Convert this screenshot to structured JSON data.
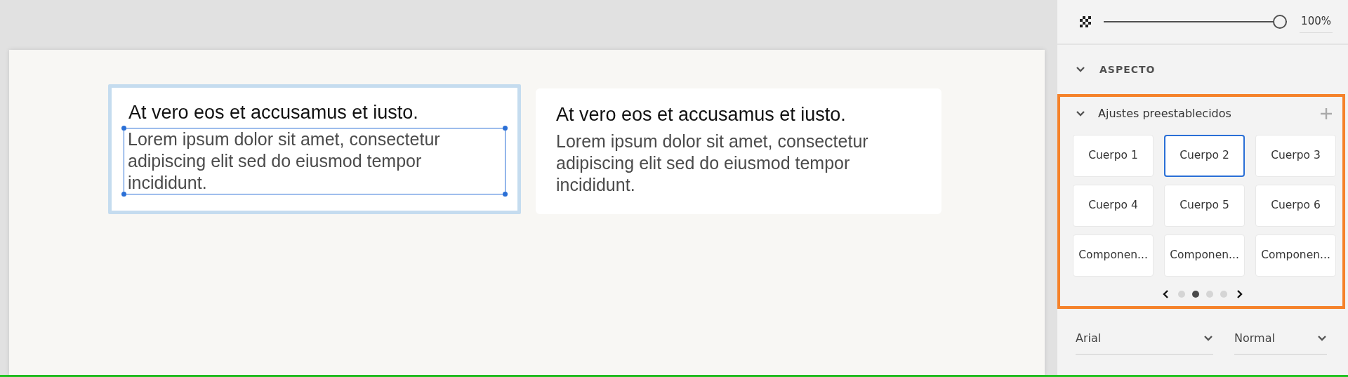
{
  "cards": [
    {
      "title": "At vero eos et accusamus et iusto.",
      "text": "Lorem ipsum dolor sit amet, consectetur adipiscing elit sed do eiusmod tempor incididunt.",
      "selected": true
    },
    {
      "title": "At vero eos et accusamus et iusto.",
      "text": "Lorem ipsum dolor sit amet, consectetur adipiscing elit sed do eiusmod tempor incididunt.",
      "selected": false
    }
  ],
  "panel": {
    "opacity": {
      "level": 1.0,
      "value": "100%"
    },
    "section": {
      "title": "ASPECTO",
      "expanded": true
    },
    "presets": {
      "title": "Ajustes preestablecidos",
      "expanded": true,
      "items": [
        {
          "label": "Cuerpo 1",
          "selected": false
        },
        {
          "label": "Cuerpo 2",
          "selected": true
        },
        {
          "label": "Cuerpo 3",
          "selected": false
        },
        {
          "label": "Cuerpo 4",
          "selected": false
        },
        {
          "label": "Cuerpo 5",
          "selected": false
        },
        {
          "label": "Cuerpo 6",
          "selected": false
        },
        {
          "label": "Componen...",
          "selected": false
        },
        {
          "label": "Componen...",
          "selected": false
        },
        {
          "label": "Componen...",
          "selected": false
        }
      ],
      "pages": [
        {
          "selected": false
        },
        {
          "selected": true
        },
        {
          "selected": false
        },
        {
          "selected": false
        }
      ]
    },
    "font": {
      "family": "Arial",
      "weight": "Normal"
    }
  }
}
